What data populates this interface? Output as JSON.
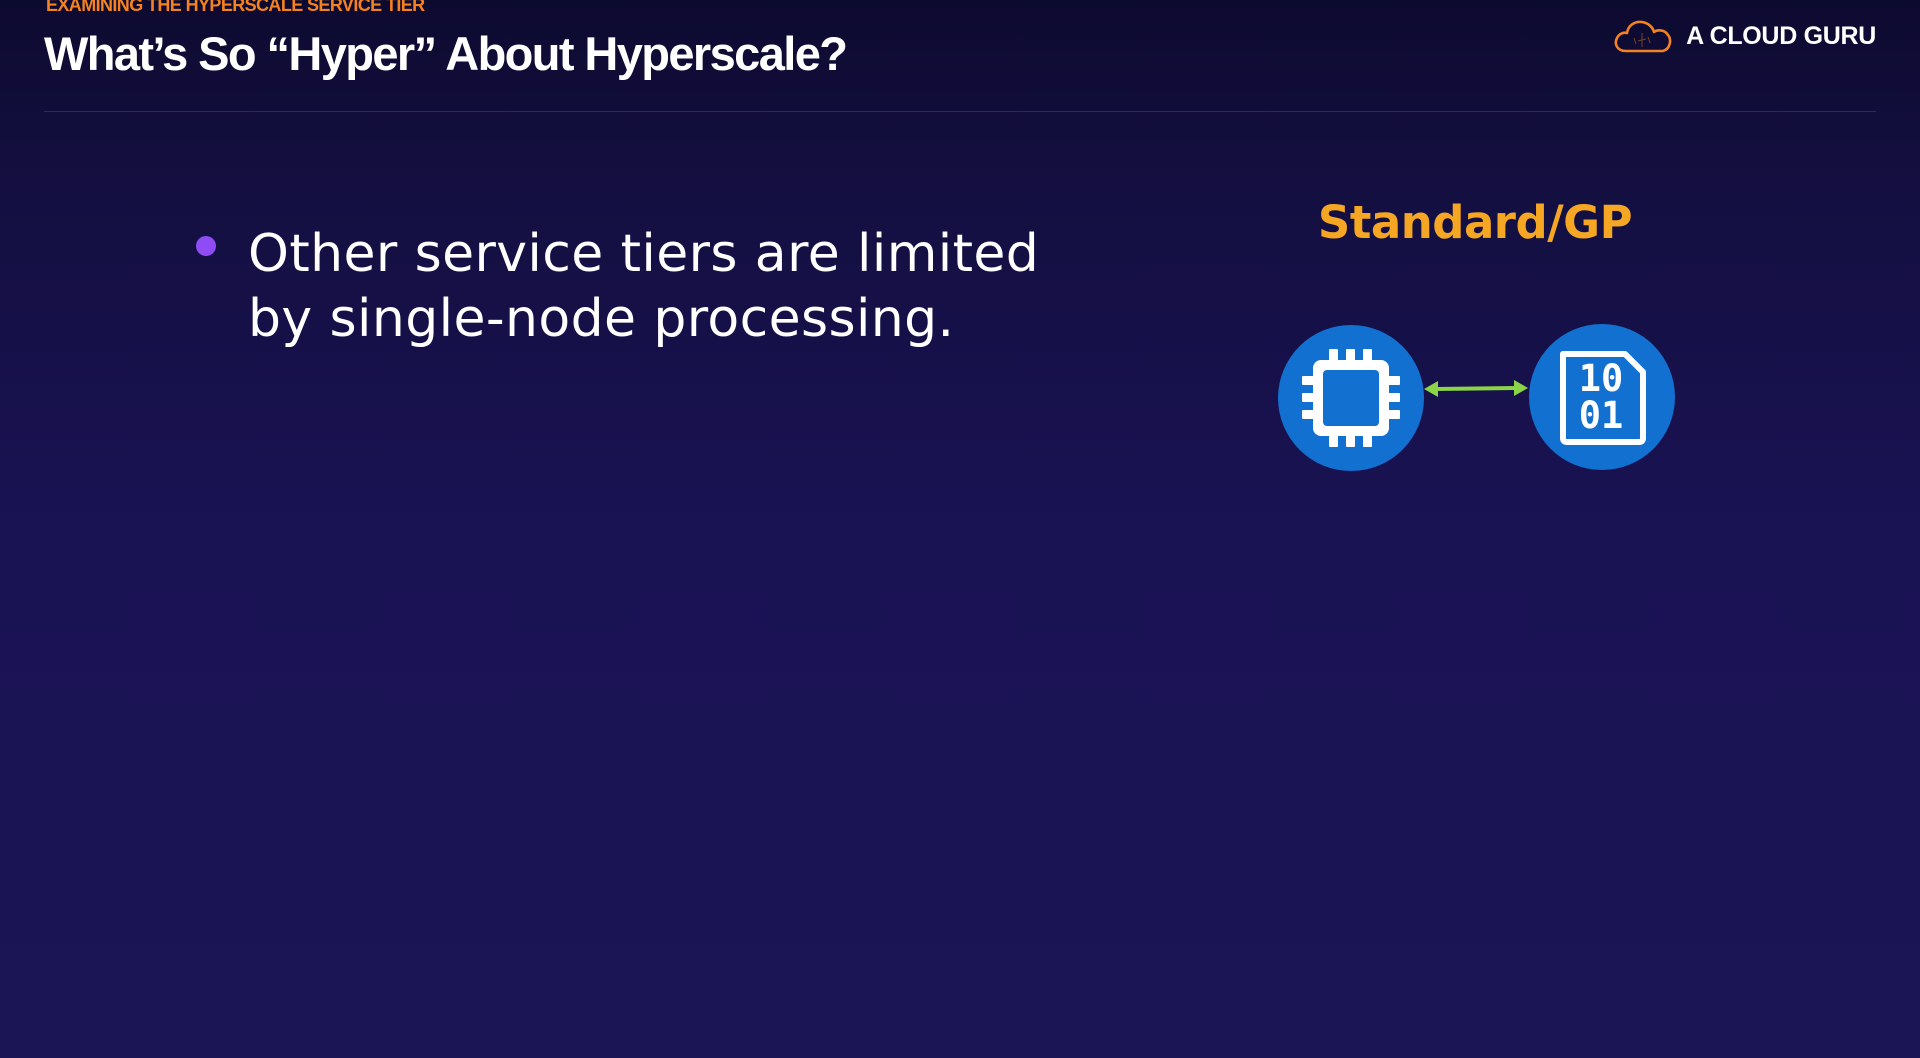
{
  "header": {
    "eyebrow": "EXAMINING THE HYPERSCALE SERVICE TIER",
    "title": "What’s So “Hyper” About Hyperscale?"
  },
  "brand": {
    "name": "A CLOUD GURU",
    "logo_icon": "cloud-icon"
  },
  "content": {
    "bullets": [
      {
        "text": "Other service tiers are limited by single-node processing."
      }
    ]
  },
  "diagram": {
    "title": "Standard/GP",
    "nodes": [
      {
        "icon": "processor-chip-icon"
      },
      {
        "icon": "binary-data-file-icon",
        "text_line1": "10",
        "text_line2": "01"
      }
    ],
    "link": "bidirectional-arrow-icon"
  },
  "colors": {
    "background": "#191253",
    "accent_orange": "#f58220",
    "title_gold": "#f5a623",
    "bullet_purple": "#8f4cf5",
    "node_blue": "#1270d0",
    "arrow_green": "#8bd448",
    "text": "#ffffff"
  }
}
